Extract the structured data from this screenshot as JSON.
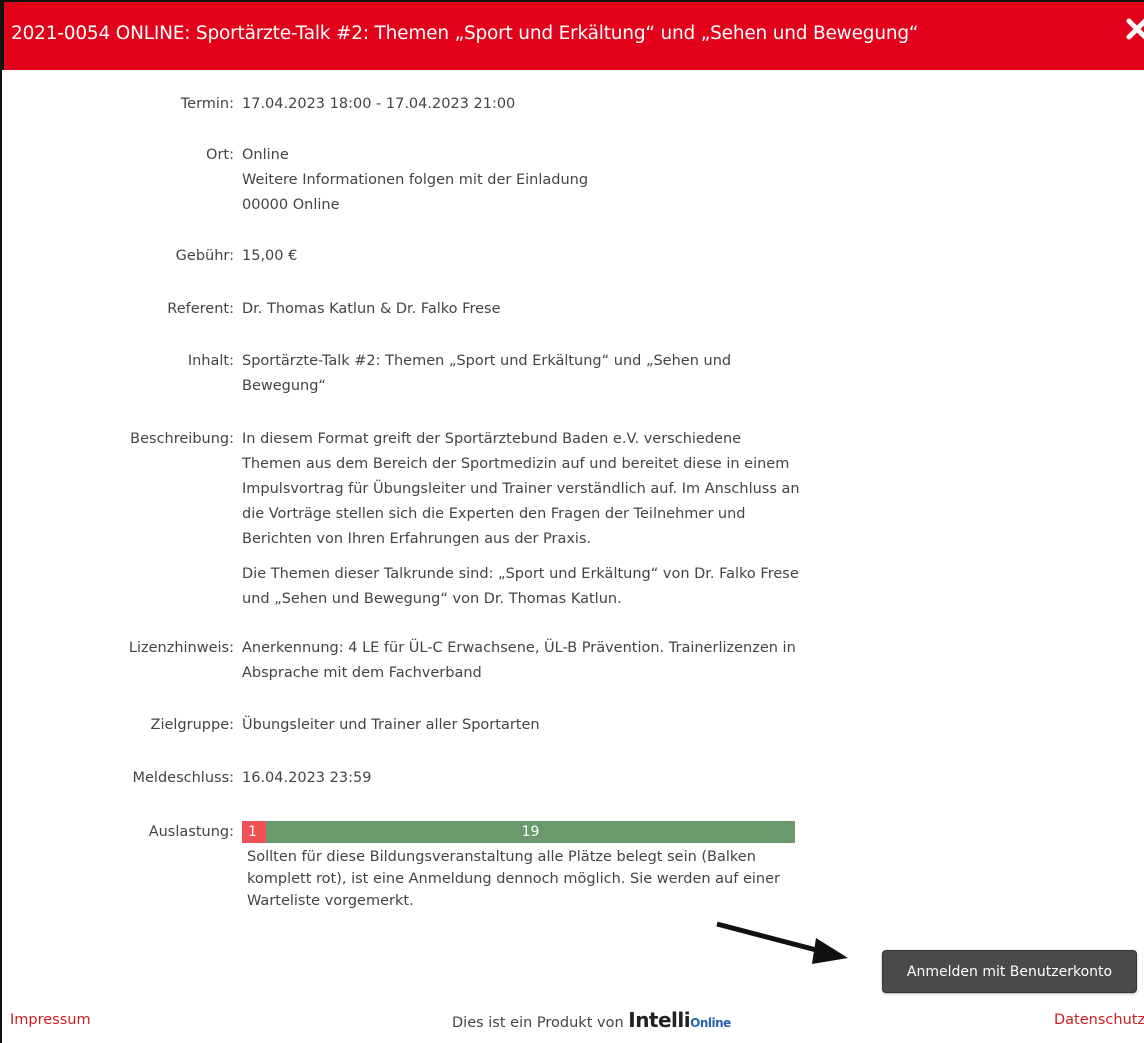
{
  "dialog": {
    "title": "2021-0054 ONLINE: Sportärzte-Talk #2: Themen „Sport und Erkältung“ und „Sehen und Bewegung“",
    "close_icon": "close-icon"
  },
  "details": {
    "termin": {
      "label": "Termin:",
      "value": "17.04.2023 18:00 - 17.04.2023 21:00"
    },
    "ort": {
      "label": "Ort:",
      "lines": [
        "Online",
        "Weitere Informationen folgen mit der Einladung",
        "00000 Online"
      ]
    },
    "gebuehr": {
      "label": "Gebühr:",
      "value": "15,00 €"
    },
    "referent": {
      "label": "Referent:",
      "value": "Dr. Thomas Katlun & Dr. Falko Frese"
    },
    "inhalt": {
      "label": "Inhalt:",
      "value": "Sportärzte-Talk #2: Themen „Sport und Erkältung“ und „Sehen und Bewegung“"
    },
    "beschreibung": {
      "label": "Beschreibung:",
      "paragraphs": [
        "In diesem Format greift der Sportärztebund Baden e.V. verschiedene Themen aus dem Bereich der Sportmedizin auf und bereitet diese in einem Impulsvortrag für Übungsleiter und Trainer verständlich auf. Im Anschluss an die Vorträge stellen sich die Experten den Fragen der Teilnehmer und Berichten von Ihren Erfahrungen aus der Praxis.",
        "Die Themen dieser Talkrunde sind: „Sport und Erkältung“ von Dr. Falko Frese und „Sehen und Bewegung“ von Dr. Thomas Katlun."
      ]
    },
    "lizenzhinweis": {
      "label": "Lizenzhinweis:",
      "value": "Anerkennung: 4 LE für ÜL-C Erwachsene, ÜL-B Prävention. Trainerlizenzen in Absprache mit dem Fachverband"
    },
    "zielgruppe": {
      "label": "Zielgruppe:",
      "value": "Übungsleiter und Trainer aller Sportarten"
    },
    "meldeschluss": {
      "label": "Meldeschluss:",
      "value": "16.04.2023 23:59"
    },
    "auslastung": {
      "label": "Auslastung:",
      "booked": "1",
      "free": "19",
      "booked_color": "#f05154",
      "free_color": "#6a9a6c",
      "note": "Sollten für diese Bildungsveranstaltung alle Plätze belegt sein (Balken komplett rot), ist eine Anmeldung dennoch möglich. Sie werden auf einer Warteliste vorgemerkt."
    }
  },
  "actions": {
    "register_label": "Anmelden mit Benutzerkonto"
  },
  "footer": {
    "impressum": "Impressum",
    "product_text": "Dies ist ein Produkt von",
    "brand_main": "Intelli",
    "brand_sub": "Online",
    "datenschutz": "Datenschutz"
  },
  "colors": {
    "accent": "#e3001b",
    "button": "#4a4a4a",
    "link": "#cc1e1e"
  }
}
